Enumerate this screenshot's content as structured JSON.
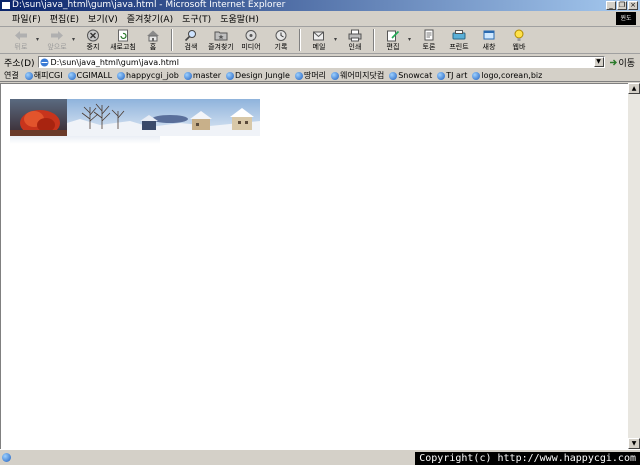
{
  "window": {
    "title": "D:\\sun\\java_html\\gum\\java.html - Microsoft Internet Explorer",
    "controls": [
      "_",
      "❐",
      "×"
    ]
  },
  "menu": [
    "파일(F)",
    "편집(E)",
    "보기(V)",
    "즐겨찾기(A)",
    "도구(T)",
    "도움말(H)"
  ],
  "ie_logo": "윈도",
  "toolbar": {
    "back": "뒤로",
    "forward": "앞으로",
    "stop": "중지",
    "refresh": "새로고침",
    "home": "홈",
    "search": "검색",
    "favorites": "즐겨찾기",
    "media": "미디어",
    "history": "기록",
    "mail": "메일",
    "print": "인쇄",
    "edit": "편집",
    "discuss": "토론",
    "printer2": "프린트",
    "new": "새창",
    "bulb": "웹바"
  },
  "address": {
    "label": "주소(D)",
    "value": "D:\\sun\\java_html\\gum\\java.html",
    "go": "이동"
  },
  "links": {
    "label": "연결",
    "items": [
      "해피CGI",
      "CGIMALL",
      "happycgi_job",
      "master",
      "Design Jungle",
      "땅머리",
      "웨어미지닷컴",
      "Snowcat",
      "TJ art",
      "logo,corean,biz"
    ]
  },
  "status": {
    "copyright": "Copyright(c) http://www.happycgi.com"
  },
  "colors": {
    "titlebar": "#0a246a",
    "chrome": "#d4d0c8",
    "content": "#ffffff"
  }
}
